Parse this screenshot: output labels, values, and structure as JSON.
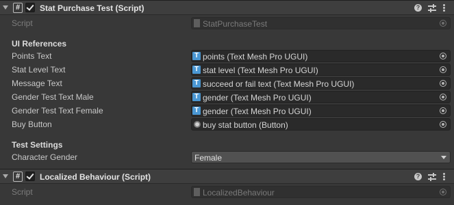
{
  "components": [
    {
      "title": "Stat Purchase Test (Script)",
      "script_label": "Script",
      "script_value": "StatPurchaseTest",
      "sections": [
        {
          "header": "UI References",
          "fields": [
            {
              "label": "Points Text",
              "value": "points (Text Mesh Pro UGUI)",
              "icon": "tmp-icon"
            },
            {
              "label": "Stat Level Text",
              "value": "stat level (Text Mesh Pro UGUI)",
              "icon": "tmp-icon"
            },
            {
              "label": "Message Text",
              "value": "succeed or fail text (Text Mesh Pro UGUI)",
              "icon": "tmp-icon"
            },
            {
              "label": "Gender Test Text Male",
              "value": "gender (Text Mesh Pro UGUI)",
              "icon": "tmp-icon"
            },
            {
              "label": "Gender Test Text Female",
              "value": "gender (Text Mesh Pro UGUI)",
              "icon": "tmp-icon"
            },
            {
              "label": "Buy Button",
              "value": "buy stat button (Button)",
              "icon": "button-icon"
            }
          ]
        },
        {
          "header": "Test Settings",
          "fields": [
            {
              "label": "Character Gender",
              "value": "Female",
              "type": "dropdown"
            }
          ]
        }
      ]
    },
    {
      "title": "Localized Behaviour (Script)",
      "script_label": "Script",
      "script_value": "LocalizedBehaviour"
    }
  ],
  "icons": {
    "script": "#",
    "tmp": "T",
    "help": "?"
  },
  "colors": {
    "background": "#383838",
    "header": "#3e3e3e",
    "field": "#2a2a2a",
    "tmp_icon": "#4a97d3"
  }
}
